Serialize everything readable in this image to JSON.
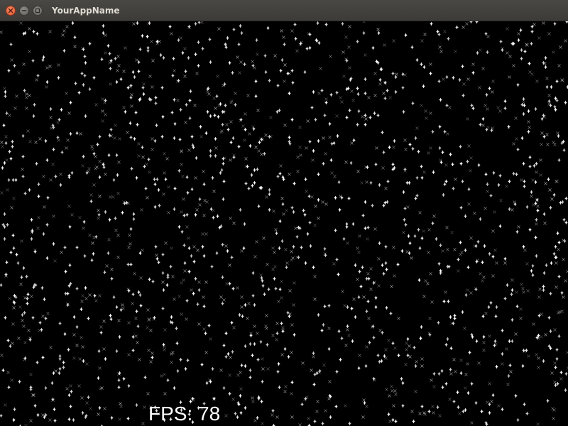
{
  "window": {
    "title": "YourAppName",
    "controls": {
      "close": "close-icon",
      "minimize": "minimize-icon",
      "maximize": "maximize-icon"
    },
    "titlebar_color": "#3c3b37",
    "close_color": "#e0552d"
  },
  "scene": {
    "background_color": "#000000",
    "star_color": "#ffffff",
    "star_shape": "sparkle"
  },
  "hud": {
    "fps_text": "FPS: 78",
    "fps_value": 78
  }
}
